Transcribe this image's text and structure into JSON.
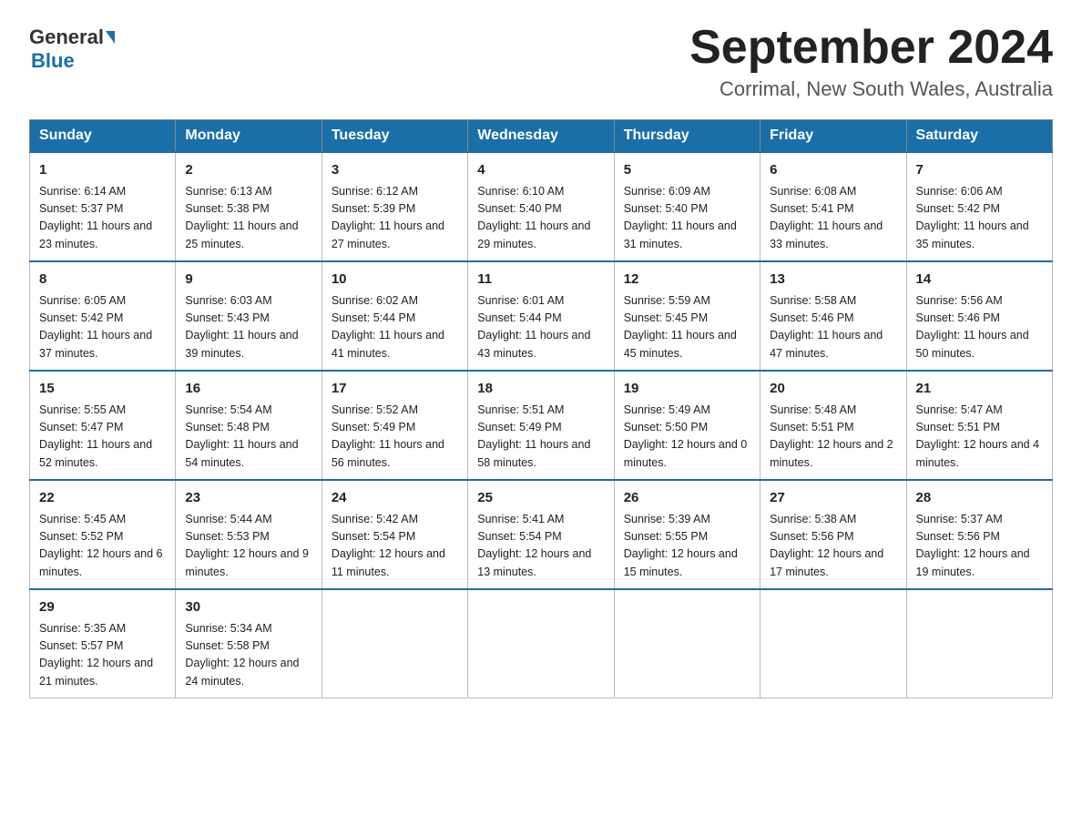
{
  "header": {
    "logo_general": "General",
    "logo_blue": "Blue",
    "month_title": "September 2024",
    "subtitle": "Corrimal, New South Wales, Australia"
  },
  "days_of_week": [
    "Sunday",
    "Monday",
    "Tuesday",
    "Wednesday",
    "Thursday",
    "Friday",
    "Saturday"
  ],
  "weeks": [
    [
      {
        "day": "1",
        "sunrise": "6:14 AM",
        "sunset": "5:37 PM",
        "daylight": "11 hours and 23 minutes."
      },
      {
        "day": "2",
        "sunrise": "6:13 AM",
        "sunset": "5:38 PM",
        "daylight": "11 hours and 25 minutes."
      },
      {
        "day": "3",
        "sunrise": "6:12 AM",
        "sunset": "5:39 PM",
        "daylight": "11 hours and 27 minutes."
      },
      {
        "day": "4",
        "sunrise": "6:10 AM",
        "sunset": "5:40 PM",
        "daylight": "11 hours and 29 minutes."
      },
      {
        "day": "5",
        "sunrise": "6:09 AM",
        "sunset": "5:40 PM",
        "daylight": "11 hours and 31 minutes."
      },
      {
        "day": "6",
        "sunrise": "6:08 AM",
        "sunset": "5:41 PM",
        "daylight": "11 hours and 33 minutes."
      },
      {
        "day": "7",
        "sunrise": "6:06 AM",
        "sunset": "5:42 PM",
        "daylight": "11 hours and 35 minutes."
      }
    ],
    [
      {
        "day": "8",
        "sunrise": "6:05 AM",
        "sunset": "5:42 PM",
        "daylight": "11 hours and 37 minutes."
      },
      {
        "day": "9",
        "sunrise": "6:03 AM",
        "sunset": "5:43 PM",
        "daylight": "11 hours and 39 minutes."
      },
      {
        "day": "10",
        "sunrise": "6:02 AM",
        "sunset": "5:44 PM",
        "daylight": "11 hours and 41 minutes."
      },
      {
        "day": "11",
        "sunrise": "6:01 AM",
        "sunset": "5:44 PM",
        "daylight": "11 hours and 43 minutes."
      },
      {
        "day": "12",
        "sunrise": "5:59 AM",
        "sunset": "5:45 PM",
        "daylight": "11 hours and 45 minutes."
      },
      {
        "day": "13",
        "sunrise": "5:58 AM",
        "sunset": "5:46 PM",
        "daylight": "11 hours and 47 minutes."
      },
      {
        "day": "14",
        "sunrise": "5:56 AM",
        "sunset": "5:46 PM",
        "daylight": "11 hours and 50 minutes."
      }
    ],
    [
      {
        "day": "15",
        "sunrise": "5:55 AM",
        "sunset": "5:47 PM",
        "daylight": "11 hours and 52 minutes."
      },
      {
        "day": "16",
        "sunrise": "5:54 AM",
        "sunset": "5:48 PM",
        "daylight": "11 hours and 54 minutes."
      },
      {
        "day": "17",
        "sunrise": "5:52 AM",
        "sunset": "5:49 PM",
        "daylight": "11 hours and 56 minutes."
      },
      {
        "day": "18",
        "sunrise": "5:51 AM",
        "sunset": "5:49 PM",
        "daylight": "11 hours and 58 minutes."
      },
      {
        "day": "19",
        "sunrise": "5:49 AM",
        "sunset": "5:50 PM",
        "daylight": "12 hours and 0 minutes."
      },
      {
        "day": "20",
        "sunrise": "5:48 AM",
        "sunset": "5:51 PM",
        "daylight": "12 hours and 2 minutes."
      },
      {
        "day": "21",
        "sunrise": "5:47 AM",
        "sunset": "5:51 PM",
        "daylight": "12 hours and 4 minutes."
      }
    ],
    [
      {
        "day": "22",
        "sunrise": "5:45 AM",
        "sunset": "5:52 PM",
        "daylight": "12 hours and 6 minutes."
      },
      {
        "day": "23",
        "sunrise": "5:44 AM",
        "sunset": "5:53 PM",
        "daylight": "12 hours and 9 minutes."
      },
      {
        "day": "24",
        "sunrise": "5:42 AM",
        "sunset": "5:54 PM",
        "daylight": "12 hours and 11 minutes."
      },
      {
        "day": "25",
        "sunrise": "5:41 AM",
        "sunset": "5:54 PM",
        "daylight": "12 hours and 13 minutes."
      },
      {
        "day": "26",
        "sunrise": "5:39 AM",
        "sunset": "5:55 PM",
        "daylight": "12 hours and 15 minutes."
      },
      {
        "day": "27",
        "sunrise": "5:38 AM",
        "sunset": "5:56 PM",
        "daylight": "12 hours and 17 minutes."
      },
      {
        "day": "28",
        "sunrise": "5:37 AM",
        "sunset": "5:56 PM",
        "daylight": "12 hours and 19 minutes."
      }
    ],
    [
      {
        "day": "29",
        "sunrise": "5:35 AM",
        "sunset": "5:57 PM",
        "daylight": "12 hours and 21 minutes."
      },
      {
        "day": "30",
        "sunrise": "5:34 AM",
        "sunset": "5:58 PM",
        "daylight": "12 hours and 24 minutes."
      },
      null,
      null,
      null,
      null,
      null
    ]
  ],
  "labels": {
    "sunrise_prefix": "Sunrise: ",
    "sunset_prefix": "Sunset: ",
    "daylight_prefix": "Daylight: "
  }
}
